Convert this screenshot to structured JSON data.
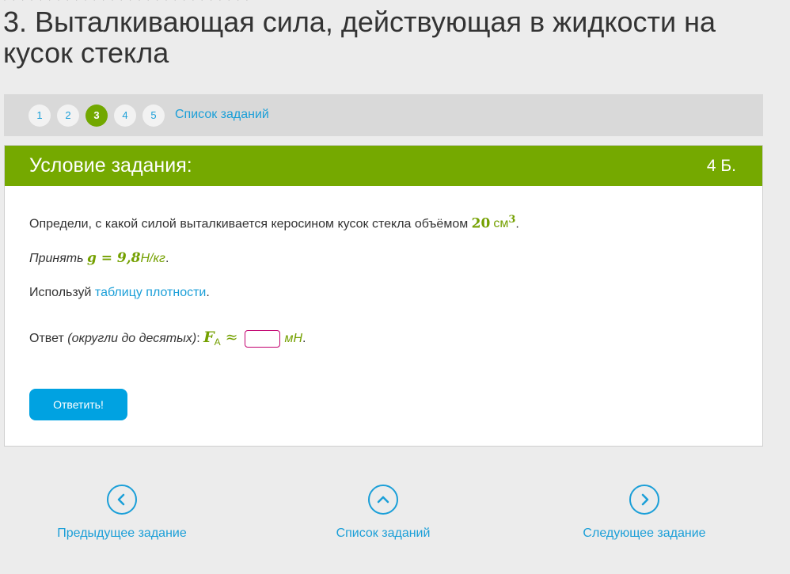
{
  "title": "3. Выталкивающая сила, действующая в жидкости на кусок стекла",
  "pagination": {
    "pages": [
      "1",
      "2",
      "3",
      "4",
      "5"
    ],
    "active": "3",
    "list_link": "Список заданий"
  },
  "task": {
    "header": "Условие задания:",
    "points": "4 Б.",
    "question_text": "Определи, с какой силой выталкивается керосином кусок стекла объёмом ",
    "volume_value": "20",
    "volume_unit": "см",
    "volume_exp": "3",
    "period": ".",
    "given_prefix": "Принять ",
    "given_formula": "g = 9,8",
    "given_unit": "Н/кг",
    "use_prefix": "Используй ",
    "use_link": "таблицу плотности",
    "answer_label": "Ответ ",
    "answer_hint": "(округли до десятых)",
    "answer_colon": ": ",
    "answer_var": "F",
    "answer_sub": "А",
    "approx": "≈",
    "answer_value": "",
    "answer_unit": "мН",
    "submit_label": "Ответить!"
  },
  "bottom_nav": {
    "prev": "Предыдущее задание",
    "list": "Список заданий",
    "next": "Следующее задание"
  },
  "colors": {
    "green": "#75a900",
    "blue": "#1b9fd8",
    "button": "#00a2e1"
  }
}
